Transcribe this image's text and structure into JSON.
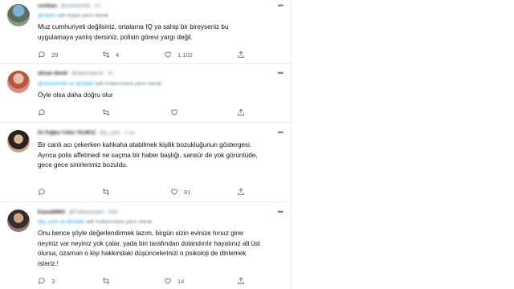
{
  "tweets": [
    {
      "name": "cevbası",
      "handle": "@cevkanrde · 2s",
      "reply_prefix": "@",
      "reply_mention": "@odaln",
      "reply_suffix": "adlı kişiye yanıt olarak",
      "body_lines": [
        "Muz cumhuriyeti değilsiniz, ortalama IQ ya sahip bir bireyseniz bu",
        "uygulamaya yanlış dersiniz, polisin görevi yargı değil."
      ],
      "replies": "29",
      "retweets": "4",
      "likes": "1.102"
    },
    {
      "name": "alican demli",
      "handle": "@alicandemli · 2s",
      "reply_prefix": "",
      "reply_mention": "@serkanride ve @odaln",
      "reply_suffix": "adlı kullanıcılara yanıt olarak",
      "body_lines": [
        "Öyle olsa daha doğru olur"
      ],
      "replies": "",
      "retweets": "",
      "likes": ""
    },
    {
      "name": "Dr.Tuğba Yıldız YILMAZ",
      "handle": "@y_yıldı · 1 sa",
      "reply_prefix": "",
      "reply_mention": "",
      "reply_suffix": "",
      "body_lines": [
        "Bir canlı acı çekerken kahkaha atabilmek kişilik bozukluğunun göstergesi.",
        "Ayrıca polis affetmedi ne saçma bir haber başlığı, sansür de yok görüntüde,",
        "gece gece sinirlerimiz bozuldu."
      ],
      "replies": "",
      "retweets": "",
      "likes": "91"
    },
    {
      "name": "Kamal0903",
      "handle": "@TuBackstack · 54d",
      "reply_prefix": "",
      "reply_mention": "@y_yıldı ve @odaln",
      "reply_suffix": "adlı kullanıcılara yanıt olarak",
      "body_lines": [
        "Onu bence şöyle değerlendirmek lazım, birgün sizin evinize hırsız girer",
        "neyiniz var neyiniz yok çalar, yada biri tarafından dolandırılır hayatınız alt üst",
        "olursa, ozaman o kişi hakkındaki düşüncelerinizi o psikoloji de dinlemek",
        "isteriz.!"
      ],
      "replies": "3",
      "retweets": "",
      "likes": "14"
    }
  ],
  "icons": {
    "reply": "reply-icon",
    "retweet": "retweet-icon",
    "like": "like-icon",
    "share": "share-icon",
    "more": "more-icon"
  },
  "colors": {
    "text": "#0f1419",
    "muted": "#657786",
    "link": "#1da1f2",
    "divider": "#e6ecf0"
  }
}
